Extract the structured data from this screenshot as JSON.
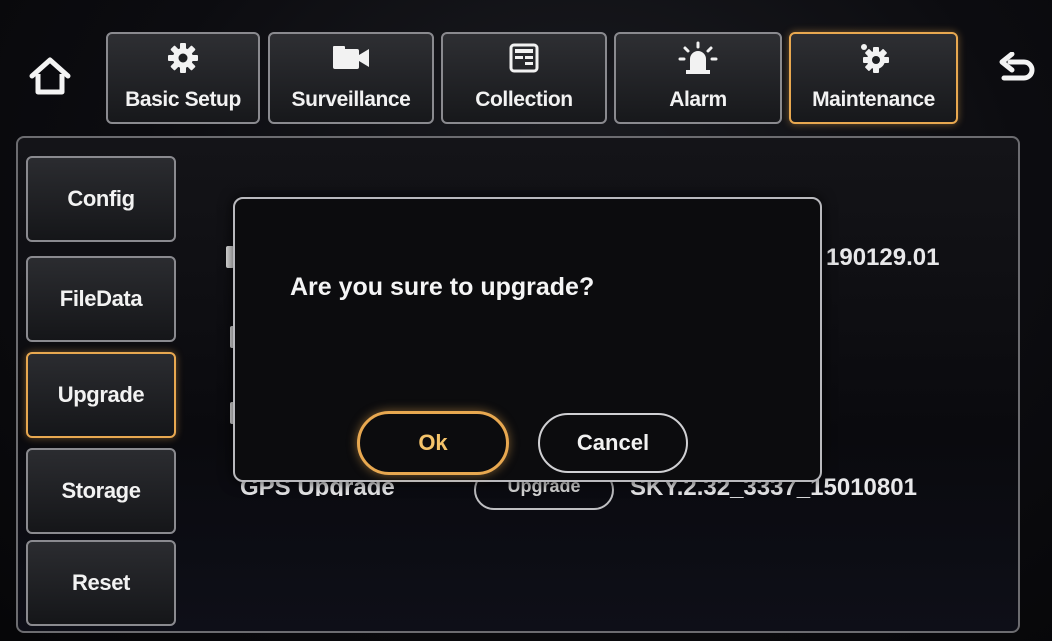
{
  "nav": {
    "tabs": [
      {
        "label": "Basic Setup",
        "icon": "gear-icon"
      },
      {
        "label": "Surveillance",
        "icon": "camera-icon"
      },
      {
        "label": "Collection",
        "icon": "collection-icon"
      },
      {
        "label": "Alarm",
        "icon": "alarm-light-icon"
      },
      {
        "label": "Maintenance",
        "icon": "maintenance-gear-icon"
      }
    ],
    "active_tab": "Maintenance",
    "home_icon": "home-icon",
    "back_icon": "back-arrow-icon"
  },
  "sidebar": {
    "items": [
      {
        "label": "Config"
      },
      {
        "label": "FileData"
      },
      {
        "label": "Upgrade"
      },
      {
        "label": "Storage"
      },
      {
        "label": "Reset"
      }
    ],
    "active_item": "Upgrade"
  },
  "content": {
    "row1_value": "190129.01",
    "gps_label": "GPS Upgrade",
    "gps_button": "Upgrade",
    "gps_value": "SKY.2.32_3337_15010801"
  },
  "dialog": {
    "message": "Are you sure to upgrade?",
    "ok_label": "Ok",
    "cancel_label": "Cancel"
  },
  "colors": {
    "accent": "#e8a850",
    "background": "#0a0a0c",
    "border": "#8a8a8f"
  }
}
